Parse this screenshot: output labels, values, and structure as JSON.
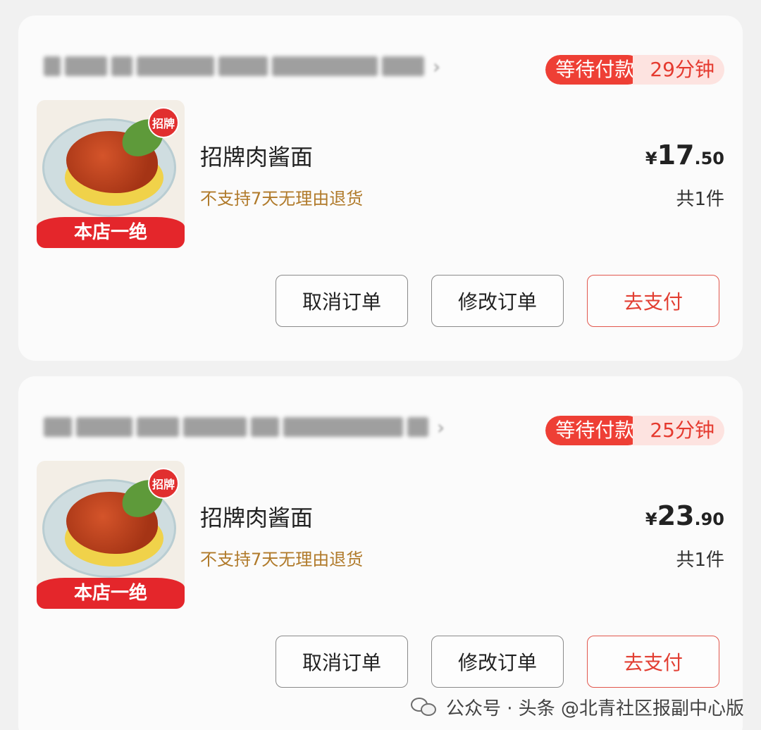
{
  "orders": [
    {
      "status_label": "等待付款",
      "timer": "29分钟",
      "item": {
        "badge": "招牌",
        "banner": "本店一绝",
        "name": "招牌肉酱面",
        "note": "不支持7天无理由退货",
        "price_symbol": "¥",
        "price_int": "17",
        "price_dec": ".50",
        "quantity": "共1件"
      },
      "buttons": {
        "cancel": "取消订单",
        "modify": "修改订单",
        "pay": "去支付"
      }
    },
    {
      "status_label": "等待付款",
      "timer": "25分钟",
      "item": {
        "badge": "招牌",
        "banner": "本店一绝",
        "name": "招牌肉酱面",
        "note": "不支持7天无理由退货",
        "price_symbol": "¥",
        "price_int": "23",
        "price_dec": ".90",
        "quantity": "共1件"
      },
      "buttons": {
        "cancel": "取消订单",
        "modify": "修改订单",
        "pay": "去支付"
      }
    }
  ],
  "watermark": {
    "text": "公众号 · 头条 @北青社区报副中心版"
  },
  "colors": {
    "accent": "#ee3f35",
    "note": "#b07a2a",
    "timer_bg": "#fde3e0"
  },
  "icons": [
    "wechat-icon"
  ]
}
